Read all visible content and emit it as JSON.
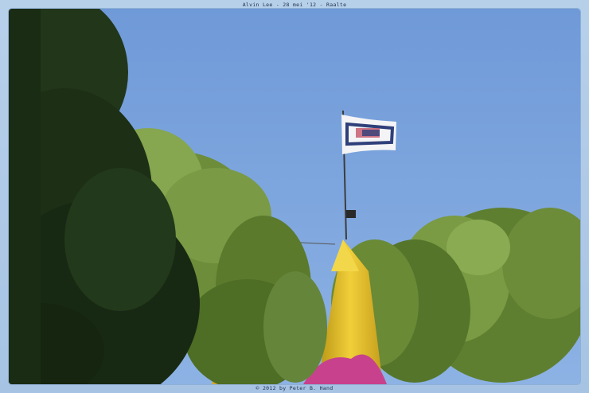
{
  "header": {
    "caption": "Alvin Lee - 28 mei '12 - Raalte"
  },
  "footer": {
    "credit": "© 2012 by Peter B. Hand"
  },
  "colors": {
    "sky": "#7ea6dc",
    "tree_dark": "#1f3317",
    "tree_light": "#6f8f3c",
    "tent_yellow": "#e3c028",
    "flag": "#f4f4f6",
    "flag_accent": "#2f3f7a"
  }
}
